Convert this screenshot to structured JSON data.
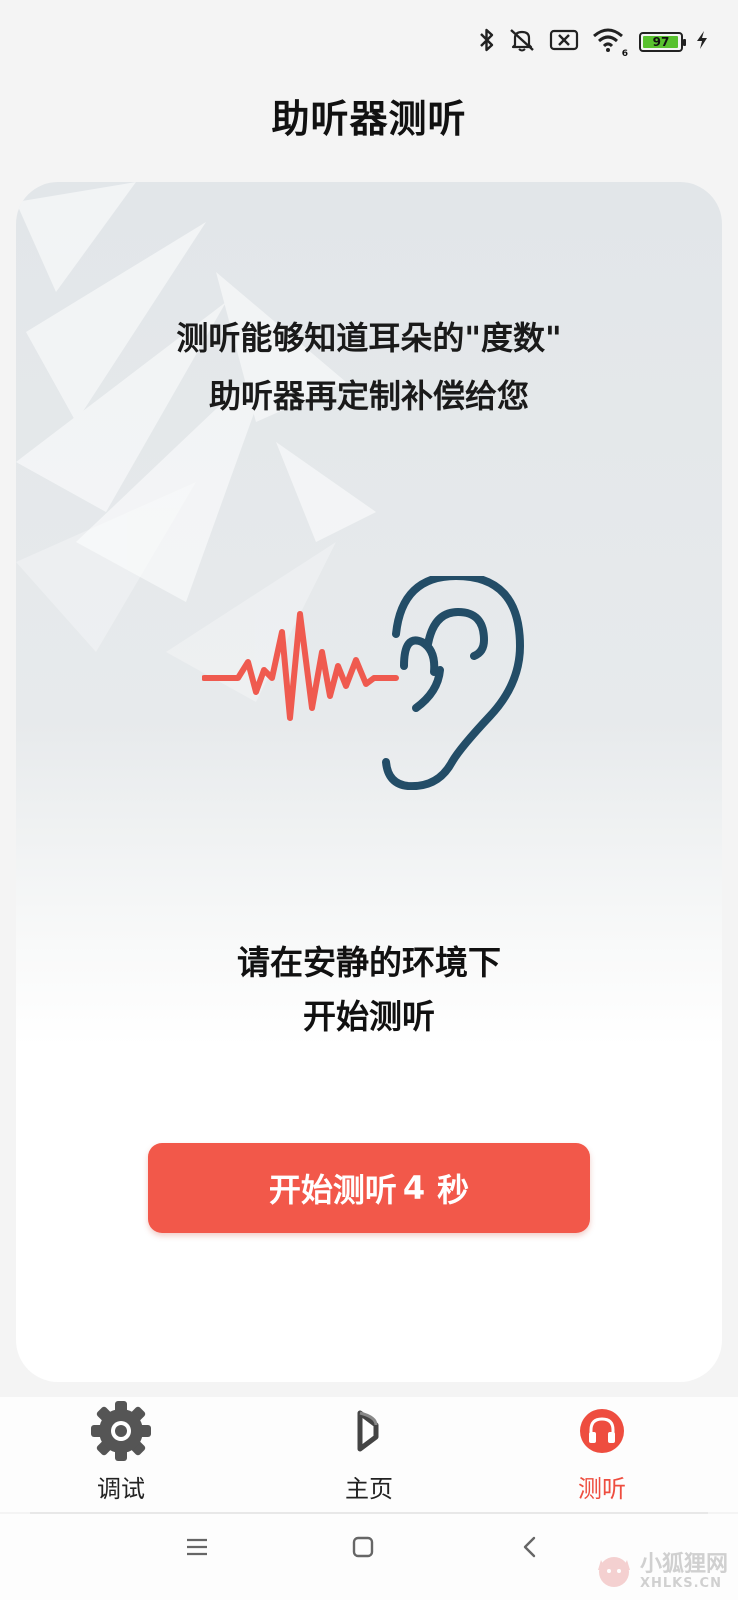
{
  "status_bar": {
    "battery_level": "97",
    "battery_fraction": 0.97,
    "wifi_badge": "6",
    "icons": [
      "bluetooth-icon",
      "mute-icon",
      "sim-off-icon",
      "wifi-icon",
      "battery-icon",
      "charging-icon"
    ],
    "battery_color": "#58c12e"
  },
  "header": {
    "title": "助听器测听"
  },
  "intro": {
    "line1": "测听能够知道耳朵的\"度数\"",
    "line2": "助听器再定制补偿给您"
  },
  "illustration": {
    "wave_color": "#ef5a4f",
    "ear_color": "#234d67",
    "icons": [
      "sound-wave-icon",
      "ear-icon"
    ]
  },
  "hint": {
    "line1": "请在安静的环境下",
    "line2": "开始测听"
  },
  "start_button": {
    "label": "开始测听",
    "countdown": "4",
    "unit": "秒",
    "color": "#f2584a"
  },
  "tabs": [
    {
      "label": "调试",
      "icon": "gear-icon",
      "active": false
    },
    {
      "label": "主页",
      "icon": "home-logo-icon",
      "active": false
    },
    {
      "label": "测听",
      "icon": "headphones-icon",
      "active": true
    }
  ],
  "active_color": "#ee4d3f",
  "nav_bar": {
    "icons": [
      "menu-icon",
      "home-square-icon",
      "back-icon"
    ]
  },
  "watermark": {
    "cn": "小狐狸网",
    "en": "XHLKS.CN"
  }
}
